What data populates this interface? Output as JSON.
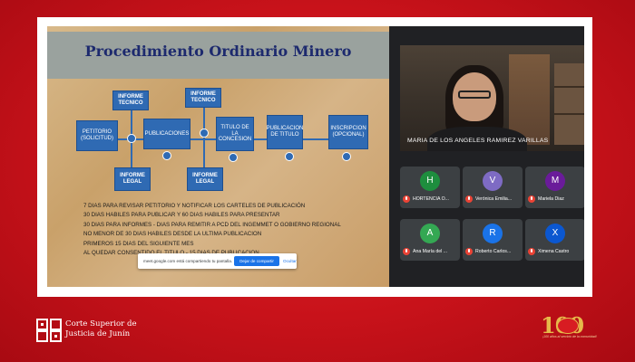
{
  "slide": {
    "title": "Procedimiento Ordinario Minero",
    "boxes": {
      "petitorio": "PETITORIO (SOLICITUD)",
      "informe_tecnico_1": "INFORME TECNICO",
      "publicaciones": "PUBLICACIONES",
      "informe_tecnico_2": "INFORME TECNICO",
      "titulo_concesion": "TITULO DE LA CONCESION",
      "publicacion_titulo": "PUBLICACION DE TITULO",
      "inscripcion": "INSCRIPCION (OPCIONAL)",
      "informe_legal_1": "INFORME LEGAL",
      "informe_legal_2": "INFORME LEGAL"
    },
    "lines": [
      "7 DIAS PARA REVISAR PETITORIO Y NOTIFICAR LOS CARTELES DE PUBLICACIÓN",
      "30 DIAS HABILES PARA PUBLICAR Y 60 DIAS HABILES PARA PRESENTAR",
      "30 DIAS PARA INFORMES - DIAS PARA REMITIR A PCD DEL INGEMMET  O GOBIERNO REGIONAL",
      " NO MENOR DE 30 DIAS HABILES DESDE LA ULTIMA PUBLICACION",
      "PRIMEROS 15 DIAS DEL SIGUIENTE MES",
      "AL QUEDAR CONSENTIDO EL TITULO - 15 DIAS DE PUBLICACION"
    ]
  },
  "share_bar": {
    "text": "meet.google.com está compartiendo tu pantalla.",
    "stop_label": "Dejar de compartir",
    "hide_label": "Ocultar"
  },
  "speaker": {
    "name": "MARIA DE LOS ANGELES RAMIREZ VARILLAS"
  },
  "participants": [
    {
      "initial": "H",
      "name": "HORTENCIA O...",
      "color": "#1e8e3e"
    },
    {
      "initial": "V",
      "name": "Verónica Emilia...",
      "color": "#7e6bc4"
    },
    {
      "initial": "M",
      "name": "Mariela Diaz",
      "color": "#6a1b9a"
    },
    {
      "initial": "A",
      "name": "Ana María del ...",
      "color": "#34a853"
    },
    {
      "initial": "R",
      "name": "Roberto Carlos...",
      "color": "#1a73e8"
    },
    {
      "initial": "X",
      "name": "Ximena Castro",
      "color": "#0b57d0"
    }
  ],
  "footer": {
    "org_line1": "Corte Superior de",
    "org_line2": "Justicia de Junín",
    "anniv_number": "100",
    "anniv_tagline": "¡100 años al servicio de la comunidad!"
  },
  "colors": {
    "background": "#c8121a",
    "slide_box": "#2f6ab3",
    "title": "#1d2a6e",
    "mic_off": "#ea4335"
  }
}
